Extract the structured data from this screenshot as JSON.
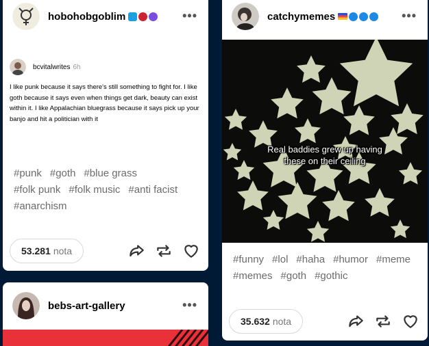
{
  "posts": [
    {
      "blog": "hobohobgoblim",
      "badges": [
        "#1aa0e0",
        "#cc2233",
        "#7a4de0"
      ],
      "reblog": {
        "name": "bcvitalwrites",
        "time": "6h"
      },
      "body": "I like punk because it says there's still something to fight for. I like goth because it says even when things get dark, beauty can exist within it. I like Appalachian bluegrass because it says pick up your banjo and hit a politician with it",
      "tags": [
        "#punk",
        "#goth",
        "#blue grass",
        "#folk punk",
        "#folk music",
        "#anti facist",
        "#anarchism"
      ],
      "notes_count": "53.281",
      "notes_label": "nota"
    },
    {
      "blog": "bebs-art-gallery"
    },
    {
      "blog": "catchymemes",
      "badges": [
        "#2d4ed8",
        "#1e88e5",
        "#1e88e5",
        "#1e88e5"
      ],
      "image_caption": "Real baddies grew up having these on their ceiling",
      "tags": [
        "#funny",
        "#lol",
        "#haha",
        "#humor",
        "#meme",
        "#memes",
        "#goth",
        "#gothic"
      ],
      "notes_count": "35.632",
      "notes_label": "nota"
    }
  ],
  "colors": {
    "background": "#001935",
    "accent_red": "#e9313a",
    "star": "#dfe6c4"
  },
  "icons": [
    "more-icon",
    "share-icon",
    "reblog-icon",
    "like-icon"
  ]
}
